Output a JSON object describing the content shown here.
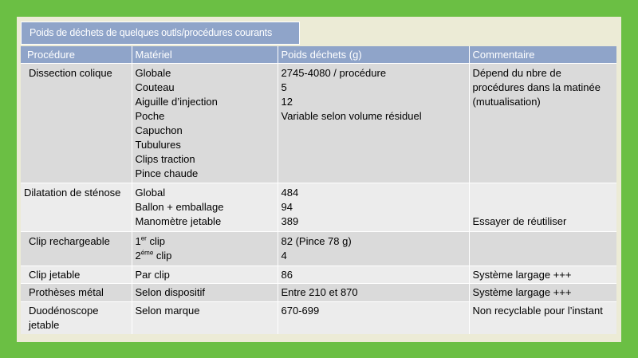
{
  "title": "Poids de déchets de quelques outls/procédures courants",
  "headers": [
    "Procédure",
    "Matériel",
    "Poids déchets (g)",
    "Commentaire"
  ],
  "rows": {
    "dissection": {
      "procedure": "Dissection colique",
      "materiel": [
        "Globale",
        "Couteau",
        "Aiguille d’injection",
        "Poche",
        "Capuchon",
        "Tubulures",
        "Clips traction",
        "Pince chaude"
      ],
      "poids": [
        "2745-4080 / procédure",
        "5",
        "12",
        "Variable selon volume résiduel"
      ],
      "commentaire": "Dépend du nbre de procédures dans la matinée (mutualisation)"
    },
    "dilatation": {
      "procedure": "Dilatation de sténose",
      "materiel": [
        "Global",
        "Ballon + emballage",
        "Manomètre jetable"
      ],
      "poids": [
        "484",
        "94",
        "389"
      ],
      "commentaire": "Essayer de réutiliser"
    },
    "clip_rech": {
      "procedure": "Clip rechargeable",
      "materiel_1_pre": "1",
      "materiel_1_sup": "er",
      "materiel_1_post": " clip",
      "materiel_2_pre": "2",
      "materiel_2_sup": "éme",
      "materiel_2_post": " clip",
      "poids": [
        "82 (Pince 78 g)",
        "4"
      ],
      "commentaire": ""
    },
    "clip_jet": {
      "procedure": "Clip jetable",
      "materiel": "Par clip",
      "poids": "86",
      "commentaire": "Système largage +++"
    },
    "protheses": {
      "procedure": "Prothèses métal",
      "materiel": "Selon dispositif",
      "poids": "Entre 210 et 870",
      "commentaire": "Système largage +++"
    },
    "duodeno": {
      "procedure": "Duodénoscope jetable",
      "materiel": "Selon marque",
      "poids": "670-699",
      "commentaire": "Non recyclable pour l’instant"
    }
  },
  "colors": {
    "background": "#6bbf44",
    "panel": "#ecebd6",
    "header": "#8fa4c9",
    "row_dark": "#dadada",
    "row_light": "#ececec"
  }
}
